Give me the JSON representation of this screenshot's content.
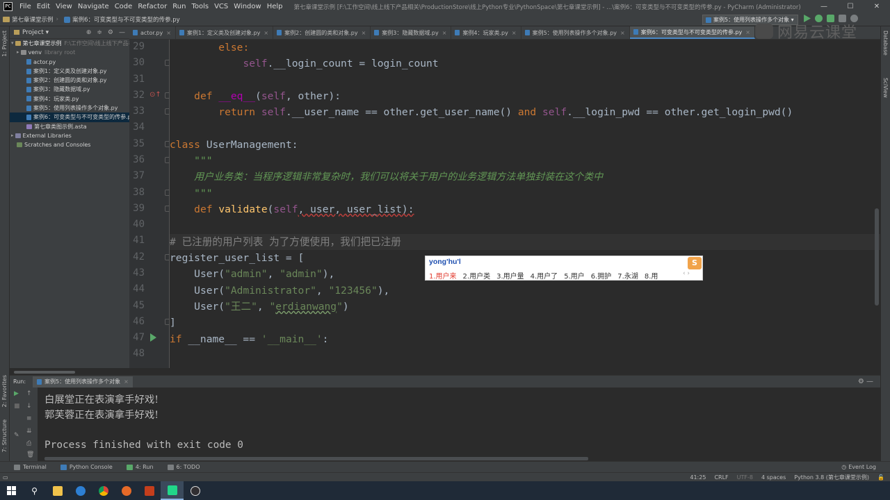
{
  "window": {
    "title": "第七章课堂示例 [F:\\工作空间\\线上线下产品相关\\ProductionStore\\线上Python专业\\PythonSpace\\第七章课堂示例] - ...\\案例6：可变类型与不可变类型的传参.py - PyCharm (Administrator)",
    "menu": [
      "File",
      "Edit",
      "View",
      "Navigate",
      "Code",
      "Refactor",
      "Run",
      "Tools",
      "VCS",
      "Window",
      "Help"
    ],
    "controls": {
      "minimize": "—",
      "maximize": "☐",
      "close": "✕"
    }
  },
  "navbar": {
    "crumb_project": "第七章课堂示例",
    "crumb_file": "案例6：可变类型与不可变类型的传参.py",
    "run_config": "案例5：使用列表操作多个对象 ▾"
  },
  "watermark": "网易云课堂",
  "project_panel": {
    "title": "Project ▾",
    "root": "第七章课堂示例",
    "root_hint": "F:\\工作空间\\线上线下产品相",
    "venv": "venv",
    "venv_hint": "library root",
    "files": [
      "actor.py",
      "案例1：定义类及创建对象.py",
      "案例2：创建圆的类和对象.py",
      "案例3：隐藏数据域.py",
      "案例4：玩家类.py",
      "案例5：使用列表操作多个对象.py",
      "案例6：可变类型与不可变类型的传参.py",
      "第七章类图示例.asta"
    ],
    "external_libraries": "External Libraries",
    "scratches": "Scratches and Consoles"
  },
  "tabs": [
    "actor.py",
    "案例1：定义类及创建对象.py",
    "案例2：创建圆的类和对象.py",
    "案例3：隐藏数据域.py",
    "案例4：玩家类.py",
    "案例5：使用列表操作多个对象.py",
    "案例6：可变类型与不可变类型的传参.py"
  ],
  "left_strip": {
    "project": "1: Project",
    "favorites": "2: Favorites",
    "structure": "7: Structure"
  },
  "right_strip": {
    "database": "Database",
    "sciview": "SciView"
  },
  "editor": {
    "line_numbers": [
      "29",
      "30",
      "31",
      "32",
      "33",
      "34",
      "35",
      "36",
      "37",
      "38",
      "39",
      "40",
      "41",
      "42",
      "43",
      "44",
      "45",
      "46",
      "47",
      "48"
    ],
    "l29_kw": "else:",
    "l30_self": "self",
    "l30_rest": ".__login_count = login_count",
    "l32_kw": "def ",
    "l32_fn": "__eq__",
    "l32_paren": "(",
    "l32_self": "self",
    "l32_rest": ", other):",
    "l33_kw": "return ",
    "l33_self1": "self",
    "l33_mid1": ".__user_name == other.get_user_name() ",
    "l33_and": "and ",
    "l33_self2": "self",
    "l33_mid2": ".__login_pwd == other.get_login_pwd()",
    "l35_kw": "class ",
    "l35_rest": "UserManagement:",
    "l36_doc": "\"\"\"",
    "l37_doc": "用户业务类：当程序逻辑非常复杂时，我们可以将关于用户的业务逻辑方法单独封装在这个类中",
    "l38_doc": "\"\"\"",
    "l39_kw": "def ",
    "l39_fn": "validate",
    "l39_paren": "(",
    "l39_self": "self",
    "l39_rest": ", user, user_list):",
    "l41_cmt": "# 已注册的用户列表 为了方便使用，我们把已注册",
    "l42_text": "register_user_list = [",
    "l43_pre": "User(",
    "l43_s1": "\"admin\"",
    "l43_comma": ", ",
    "l43_s2": "\"admin\"",
    "l43_post": "),",
    "l44_pre": "User(",
    "l44_s1": "\"Administrator\"",
    "l44_comma": ", ",
    "l44_s2": "\"123456\"",
    "l44_post": "),",
    "l45_pre": "User(",
    "l45_s1": "\"王二\"",
    "l45_comma": ", ",
    "l45_q1": "\"",
    "l45_typo": "erdianwang",
    "l45_q2": "\"",
    "l45_post": ")",
    "l46_text": "]",
    "l47_kw": "if ",
    "l47_mid": "__name__ == ",
    "l47_str": "'__main__'",
    "l47_post": ":"
  },
  "ime": {
    "composition": "yong'hu'l",
    "candidates": [
      "1.用户来",
      "2.用户类",
      "3.用户量",
      "4.用户了",
      "5.用户",
      "6.拥护",
      "7.永湖",
      "8.用"
    ],
    "arrows": "‹ ›",
    "logo": "S"
  },
  "run_panel": {
    "label": "Run:",
    "tab": "案例5：使用列表操作多个对象",
    "output": [
      "白展堂正在表演拿手好戏!",
      "郭芙蓉正在表演拿手好戏!",
      "Process finished with exit code 0"
    ]
  },
  "tool_windows": {
    "terminal": "Terminal",
    "python_console": "Python Console",
    "run": "4: Run",
    "todo": "6: TODO",
    "event_log": "Event Log"
  },
  "status": {
    "position": "41:25",
    "line_sep": "CRLF",
    "encoding": "UTF-8",
    "indent": "4 spaces",
    "interpreter": "Python 3.8 (第七章课堂示例)"
  },
  "colors": {
    "keyword": "#cc7832",
    "string": "#6a8759",
    "self": "#94558d",
    "function": "#ffc66d",
    "comment": "#808080"
  }
}
